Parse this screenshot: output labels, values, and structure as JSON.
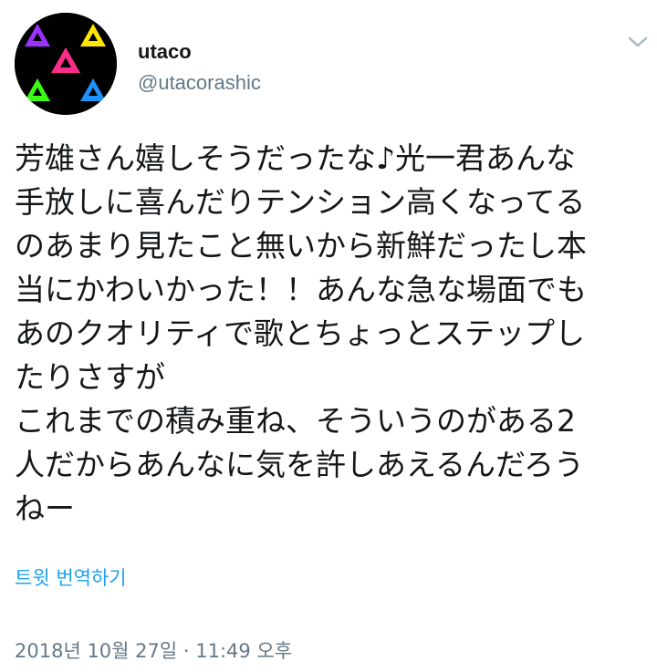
{
  "tweet": {
    "display_name": "utaco",
    "handle": "@utacorashic",
    "text_lines": [
      "芳雄さん嬉しそうだったな♪光一君あんな",
      "手放しに喜んだりテンション高くなってる",
      "のあまり見たこと無いから新鮮だったし本",
      "当にかわいかった！！あんな急な場面でも",
      "あのクオリティで歌とちょっとステップし",
      "たりさすが",
      "これまでの積み重ね、そういうのがある2",
      "人だからあんなに気を許しあえるんだろう",
      "ねー"
    ],
    "translate_label": "트윗 번역하기",
    "timestamp": "2018년 10월 27일 · 11:49 오후"
  },
  "icons": {
    "menu": "chevron-down-icon"
  },
  "colors": {
    "link": "#1da1f2",
    "secondary": "#657786",
    "text": "#14171a",
    "avatar_bg": "#000000",
    "avatar_triangles": [
      "#9b30ff",
      "#ffe600",
      "#ff2d8a",
      "#39ff14",
      "#1e90ff"
    ]
  }
}
